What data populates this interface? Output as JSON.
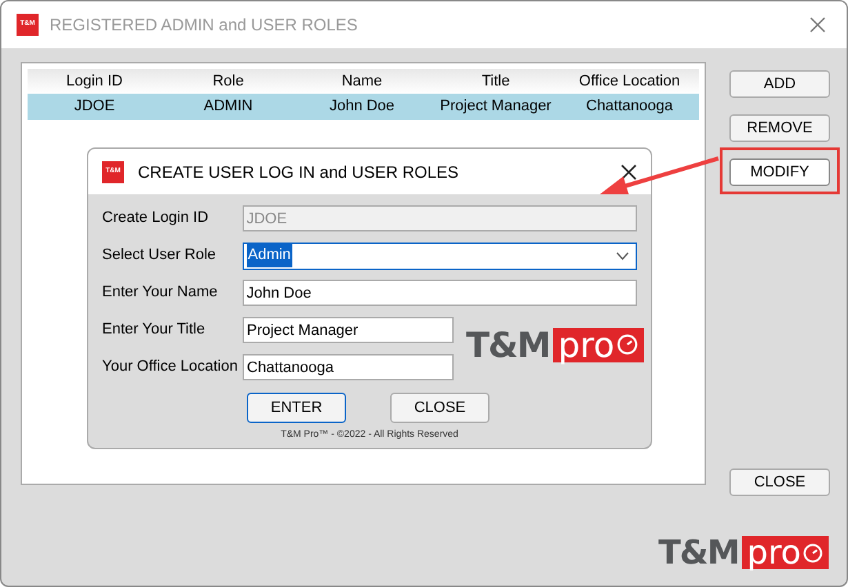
{
  "window": {
    "badge": "T&M",
    "title": "REGISTERED ADMIN and USER ROLES"
  },
  "table": {
    "columns": [
      "Login ID",
      "Role",
      "Name",
      "Title",
      "Office Location"
    ],
    "rows": [
      {
        "cells": [
          "JDOE",
          "ADMIN",
          "John Doe",
          "Project Manager",
          "Chattanooga"
        ],
        "selected": true
      }
    ]
  },
  "side_buttons": [
    {
      "label": "ADD",
      "highlighted": false
    },
    {
      "label": "REMOVE",
      "highlighted": false
    },
    {
      "label": "MODIFY",
      "highlighted": true
    }
  ],
  "close_button": "CLOSE",
  "logo": {
    "main": "T&M",
    "accent": "pro"
  },
  "dialog": {
    "badge": "T&M",
    "title": "CREATE USER LOG IN and USER ROLES",
    "fields": [
      {
        "kind": "text",
        "label": "Create Login ID",
        "value": "JDOE",
        "readonly": true
      },
      {
        "kind": "select",
        "label": "Select User Role",
        "value": "Admin",
        "readonly": false
      },
      {
        "kind": "text",
        "label": "Enter Your Name",
        "value": "John Doe",
        "readonly": false
      },
      {
        "kind": "text",
        "label": "Enter Your Title",
        "value": "Project Manager",
        "readonly": false
      },
      {
        "kind": "text",
        "label": "Your Office Location",
        "value": "Chattanooga",
        "readonly": false
      }
    ],
    "logo": {
      "main": "T&M",
      "accent": "pro"
    },
    "buttons": [
      {
        "label": "ENTER",
        "default": true
      },
      {
        "label": "CLOSE",
        "default": false
      }
    ],
    "footer": "T&M Pro™ - ©2022 - All Rights Reserved"
  }
}
